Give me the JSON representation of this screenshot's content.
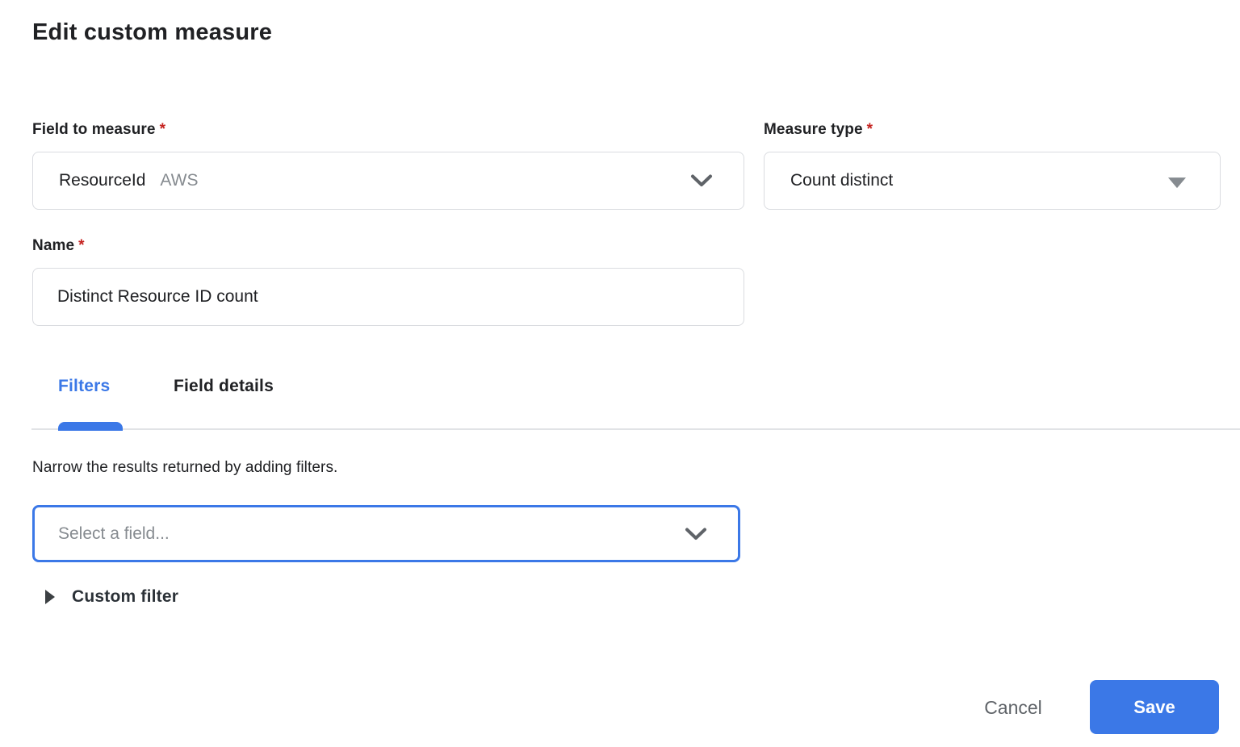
{
  "page": {
    "title": "Edit custom measure"
  },
  "form": {
    "field_to_measure": {
      "label": "Field to measure",
      "required_marker": "*",
      "value": "ResourceId",
      "value_suffix": "AWS"
    },
    "measure_type": {
      "label": "Measure type",
      "required_marker": "*",
      "value": "Count distinct"
    },
    "name": {
      "label": "Name",
      "required_marker": "*",
      "value": "Distinct Resource ID count"
    }
  },
  "tabs": {
    "filters": {
      "label": "Filters",
      "active": true
    },
    "field_details": {
      "label": "Field details",
      "active": false
    }
  },
  "filters_panel": {
    "description": "Narrow the results returned by adding filters.",
    "field_select_placeholder": "Select a field...",
    "custom_filter": {
      "label": "Custom filter",
      "collapsed": true
    }
  },
  "actions": {
    "cancel": "Cancel",
    "save": "Save"
  },
  "icons": {
    "field_to_measure_dropdown": "chevron-down",
    "measure_type_dropdown": "triangle-down",
    "filter_field_dropdown": "chevron-down",
    "custom_filter_disclosure": "triangle-right"
  },
  "colors": {
    "accent_blue": "#3B78E7",
    "required_red": "#C5221F",
    "text_dark": "#202124",
    "text_secondary": "#868B90",
    "border_gray": "#DADCE0",
    "divider_gray": "#E1E3E6"
  }
}
